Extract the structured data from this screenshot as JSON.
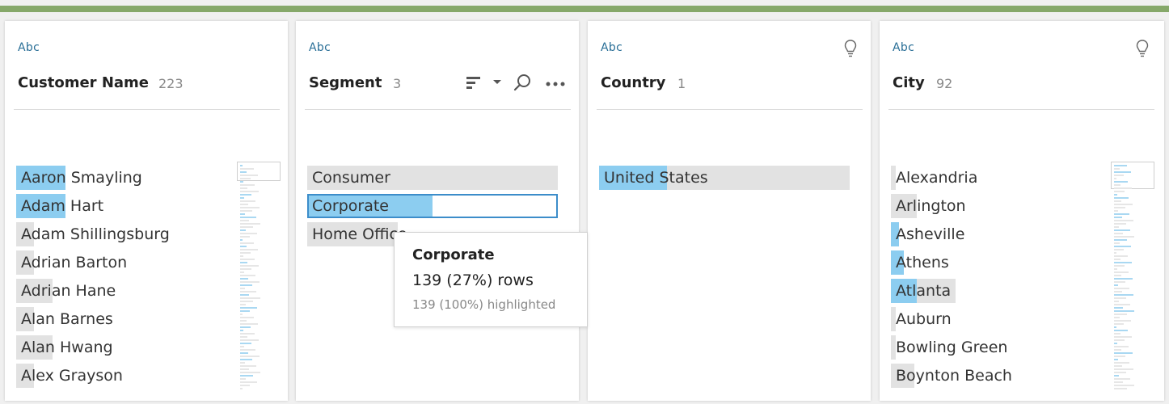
{
  "colors": {
    "accent_bar": "#86a86a",
    "highlight": "#8ccdf0",
    "bar_bg": "#e2e2e2",
    "type_label": "#2a6f97",
    "selection_outline": "#3c8dca"
  },
  "cards": [
    {
      "type": "Abc",
      "name": "Customer Name",
      "count": "223",
      "values": [
        {
          "label": "Aaron Smayling",
          "fraction": 0.19,
          "highlight": 0.19
        },
        {
          "label": "Adam Hart",
          "fraction": 0.19,
          "highlight": 0.19
        },
        {
          "label": "Adam Shillingsburg",
          "fraction": 0.07,
          "highlight": 0
        },
        {
          "label": "Adrian Barton",
          "fraction": 0.07,
          "highlight": 0
        },
        {
          "label": "Adrian Hane",
          "fraction": 0.14,
          "highlight": 0
        },
        {
          "label": "Alan Barnes",
          "fraction": 0.07,
          "highlight": 0
        },
        {
          "label": "Alan Hwang",
          "fraction": 0.14,
          "highlight": 0
        },
        {
          "label": "Alex Grayson",
          "fraction": 0.07,
          "highlight": 0
        }
      ]
    },
    {
      "type": "Abc",
      "name": "Segment",
      "count": "3",
      "values": [
        {
          "label": "Consumer",
          "fraction": 1.0,
          "highlight": 0
        },
        {
          "label": "Corporate",
          "fraction": 0.5,
          "highlight": 0.5,
          "selected": true
        },
        {
          "label": "Home Office",
          "fraction": 0.36,
          "highlight": 0
        }
      ]
    },
    {
      "type": "Abc",
      "name": "Country",
      "count": "1",
      "values": [
        {
          "label": "United States",
          "fraction": 1.0,
          "highlight": 0.27
        }
      ]
    },
    {
      "type": "Abc",
      "name": "City",
      "count": "92",
      "values": [
        {
          "label": "Alexandria",
          "fraction": 0.02,
          "highlight": 0
        },
        {
          "label": "Arlington",
          "fraction": 0.1,
          "highlight": 0
        },
        {
          "label": "Asheville",
          "fraction": 0.03,
          "highlight": 0.03
        },
        {
          "label": "Athens",
          "fraction": 0.05,
          "highlight": 0.05
        },
        {
          "label": "Atlanta",
          "fraction": 0.25,
          "highlight": 0.1
        },
        {
          "label": "Auburn",
          "fraction": 0.02,
          "highlight": 0
        },
        {
          "label": "Bowling Green",
          "fraction": 0.02,
          "highlight": 0
        },
        {
          "label": "Boynton Beach",
          "fraction": 0.09,
          "highlight": 0
        }
      ]
    }
  ],
  "tooltip": {
    "title": "Corporate",
    "rows": "139 (27%) rows",
    "highlighted": "139 (100%) highlighted"
  },
  "icons": {
    "idea": "lightbulb-icon",
    "sort": "sort-icon",
    "dropdown": "chevron-down-icon",
    "search": "search-icon",
    "more": "more-options-icon"
  }
}
